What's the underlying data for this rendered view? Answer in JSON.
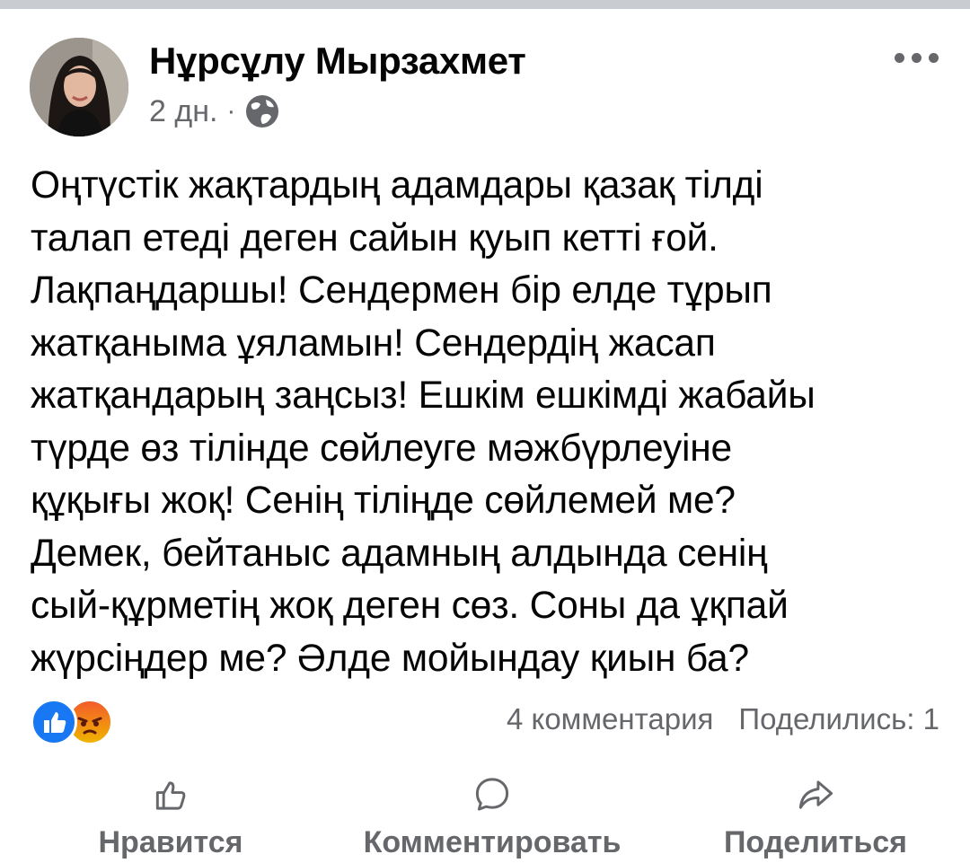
{
  "post": {
    "author": "Нұрсұлу Мырзахмет",
    "time": "2 дн.",
    "separator": "·",
    "privacy_icon": "globe-icon",
    "more_icon": "more-icon",
    "lines": [
      "Оңтүстік жақтардың адамдары қазақ тілді",
      "талап етеді деген сайын қуып кетті ғой.",
      "Лақпаңдаршы! Сендермен бір елде тұрып",
      "жатқаныма ұяламын! Сендердің жасап",
      "жатқандарың заңсыз! Ешкім ешкімді жабайы",
      "түрде өз тілінде сөйлеуге мәжбүрлеуіне",
      "құқығы жоқ! Сенің тіліңде сөйлемей ме?",
      "Демек, бейтаныс адамның алдында сенің",
      "сый-құрметің жоқ деген сөз. Соны да ұқпай",
      "жүрсіңдер ме? Әлде мойындау қиын ба?"
    ]
  },
  "reactions": {
    "icons": [
      "like-reaction-icon",
      "angry-reaction-icon"
    ],
    "colors": {
      "like": "#1877f2",
      "angry_top": "#f25c2a",
      "angry_bottom": "#f0b400"
    }
  },
  "stats": {
    "comments": "4 комментария",
    "shares": "Поделились: 1"
  },
  "actions": {
    "like": "Нравится",
    "comment": "Комментировать",
    "share": "Поделиться"
  },
  "colors": {
    "text": "#050505",
    "secondary": "#65676b",
    "divider": "#c9ccd1"
  }
}
